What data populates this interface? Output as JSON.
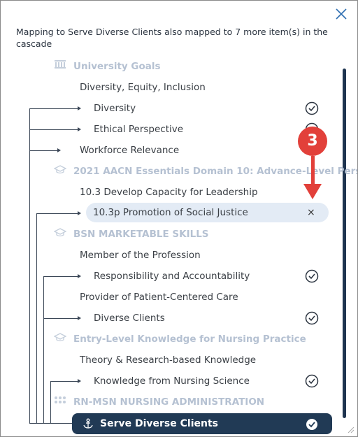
{
  "header": {
    "message": "Mapping to Serve Diverse Clients also mapped to 7 more item(s) in the cascade"
  },
  "tree": {
    "goal1": "University Goals",
    "g1_item1": "Diversity, Equity, Inclusion",
    "g1_item2": "Diversity",
    "g1_item3": "Ethical Perspective",
    "g1_item4": "Workforce Relevance",
    "goal2": "2021 AACN Essentials Domain 10: Advance-Level Pers…",
    "g2_item1": "10.3 Develop Capacity for Leadership",
    "g2_item2": "10.3p Promotion of Social Justice",
    "goal3": "BSN MARKETABLE SKILLS",
    "g3_item1": "Member of the Profession",
    "g3_item2": "Responsibility and Accountability",
    "g3_item3": "Provider of Patient-Centered Care",
    "g3_item4": "Diverse Clients",
    "goal4": "Entry-Level Knowledge for Nursing Practice",
    "g4_item1": "Theory & Research-based Knowledge",
    "g4_item2": "Knowledge from Nursing Science",
    "goal5": "RN-MSN NURSING ADMINISTRATION",
    "selected": "Serve Diverse Clients"
  },
  "remove_symbol": "×",
  "annotation": {
    "step": "3"
  },
  "icons": {
    "close": "close-icon",
    "university": "university-icon",
    "graduation": "graduation-cap-icon",
    "anchor": "anchor-icon",
    "check": "check-circle-icon"
  },
  "colors": {
    "navy": "#213a55",
    "goal_text": "#b5c1d2",
    "highlight": "#e3ebf5",
    "badge": "#e2403a"
  }
}
